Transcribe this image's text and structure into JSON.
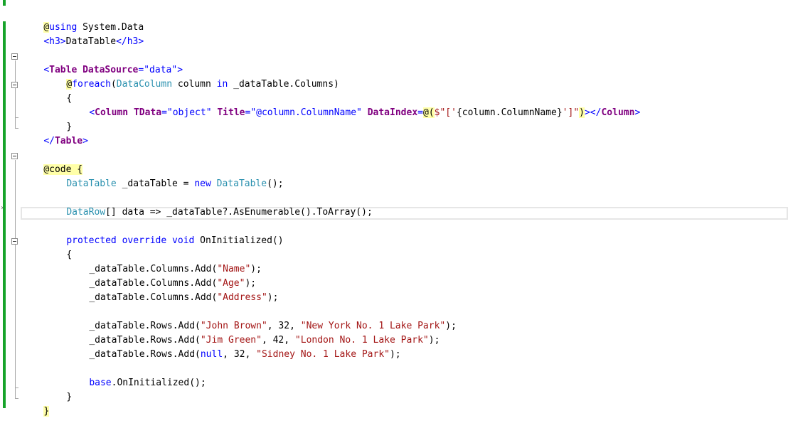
{
  "code_lines": [
    "@using System.Data",
    "<h3>DataTable</h3>",
    "",
    "<Table DataSource=\"data\">",
    "    @foreach(DataColumn column in _dataTable.Columns)",
    "    {",
    "        <Column TData=\"object\" Title=\"@column.ColumnName\" DataIndex=@($\"['{column.ColumnName}']\")></Column>",
    "    }",
    "</Table>",
    "",
    "@code {",
    "    DataTable _dataTable = new DataTable();",
    "",
    "    DataRow[] data => _dataTable?.AsEnumerable().ToArray();",
    "",
    "    protected override void OnInitialized()",
    "    {",
    "        _dataTable.Columns.Add(\"Name\");",
    "        _dataTable.Columns.Add(\"Age\");",
    "        _dataTable.Columns.Add(\"Address\");",
    "",
    "        _dataTable.Rows.Add(\"John Brown\", 32, \"New York No. 1 Lake Park\");",
    "        _dataTable.Rows.Add(\"Jim Green\", 42, \"London No. 1 Lake Park\");",
    "        _dataTable.Rows.Add(null, 32, \"Sidney No. 1 Lake Park\");",
    "",
    "        base.OnInitialized();",
    "    }",
    "}"
  ],
  "tokens": {
    "l0": [
      "@",
      "using",
      " System.Data"
    ],
    "l1": [
      "<h3>",
      "DataTable",
      "</h3>"
    ],
    "l3": [
      "<",
      "Table",
      " ",
      "DataSource",
      "=",
      "\"data\"",
      ">"
    ],
    "l4": [
      "@",
      "foreach",
      "(",
      "DataColumn",
      " column ",
      "in",
      " _dataTable.Columns)"
    ],
    "l5": [
      "{"
    ],
    "l6": [
      "<",
      "Column",
      " ",
      "TData",
      "=",
      "\"object\"",
      " ",
      "Title",
      "=",
      "\"@column.ColumnName\"",
      " ",
      "DataIndex",
      "=",
      "@(",
      "$\"['",
      "{column.ColumnName}",
      "']\"",
      ")",
      "></",
      "Column",
      ">"
    ],
    "l7": [
      "}"
    ],
    "l8": [
      "</",
      "Table",
      ">"
    ],
    "l10": [
      "@",
      "code",
      " {"
    ],
    "l11": [
      "DataTable",
      " _dataTable = ",
      "new",
      " ",
      "DataTable",
      "();"
    ],
    "l13": [
      "DataRow",
      "[] data => _dataTable?.AsEnumerable().ToArray();"
    ],
    "l15": [
      "protected",
      " ",
      "override",
      " ",
      "void",
      " OnInitialized()"
    ],
    "l16": [
      "{"
    ],
    "l17": [
      "_dataTable.Columns.Add(",
      "\"Name\"",
      ");"
    ],
    "l18": [
      "_dataTable.Columns.Add(",
      "\"Age\"",
      ");"
    ],
    "l19": [
      "_dataTable.Columns.Add(",
      "\"Address\"",
      ");"
    ],
    "l21": [
      "_dataTable.Rows.Add(",
      "\"John Brown\"",
      ", 32, ",
      "\"New York No. 1 Lake Park\"",
      ");"
    ],
    "l22": [
      "_dataTable.Rows.Add(",
      "\"Jim Green\"",
      ", 42, ",
      "\"London No. 1 Lake Park\"",
      ");"
    ],
    "l23": [
      "_dataTable.Rows.Add(",
      "null",
      ", 32, ",
      "\"Sidney No. 1 Lake Park\"",
      ");"
    ],
    "l25": [
      "base",
      ".OnInitialized();"
    ],
    "l26": [
      "}"
    ],
    "l27": [
      "}"
    ]
  },
  "colors": {
    "keyword": "#0000ff",
    "type": "#2b91af",
    "string": "#a31515",
    "razor_tag": "#800080",
    "html_tag": "#800000",
    "razor_highlight": "#ffffa8",
    "change_bar": "#17a32a"
  }
}
